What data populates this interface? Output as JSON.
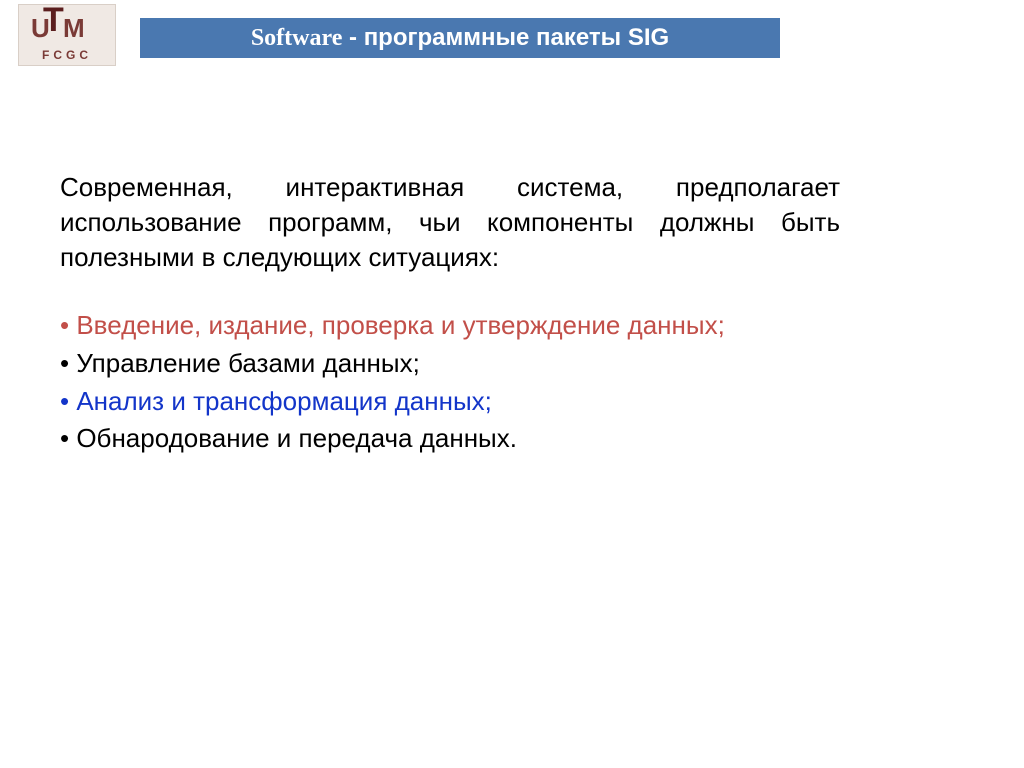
{
  "logo": {
    "t": "T",
    "u": "U",
    "m": "M",
    "sub": "FCGC"
  },
  "title": {
    "serif_part": "Software",
    "dash": " - ",
    "rest": "программные пакеты SIG"
  },
  "intro": "Современная, интерактивная система, предполагает использование программ, чьи компоненты должны быть полезными в следующих ситуациях:",
  "bullets": [
    {
      "text": "Введение, издание, проверка и утверждение данных;",
      "color": "red",
      "justify": true
    },
    {
      "text": "Управление базами данных;",
      "color": "black",
      "justify": false
    },
    {
      "text": "Анализ и трансформация данных;",
      "color": "blue",
      "justify": false
    },
    {
      "text": "Обнародование и передача данных.",
      "color": "black",
      "justify": false
    }
  ]
}
